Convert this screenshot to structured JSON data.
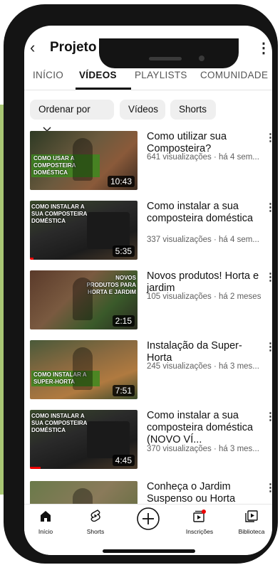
{
  "channel": {
    "title": "Projeto Raiz"
  },
  "tabs": [
    {
      "label": "INÍCIO"
    },
    {
      "label": "VÍDEOS"
    },
    {
      "label": "PLAYLISTS"
    },
    {
      "label": "COMUNIDADE"
    }
  ],
  "chips": {
    "sort": "Ordenar por",
    "videos": "Vídeos",
    "shorts": "Shorts"
  },
  "videos": [
    {
      "title": "Como utilizar sua Composteira?",
      "meta": "641 visualizações · há 4 sem...",
      "duration": "10:43",
      "thumb_text": "COMO USAR A COMPOSTEIRA DOMÉSTICA",
      "progress": 0.0
    },
    {
      "title": "Como instalar a sua composteira doméstica",
      "meta": "337 visualizações · há 4 sem...",
      "duration": "5:35",
      "thumb_text": "COMO INSTALAR A SUA COMPOSTEIRA DOMÉSTICA",
      "progress": 0.03
    },
    {
      "title": "Novos produtos! Horta e jardim",
      "meta": "105 visualizações · há 2 meses",
      "duration": "2:15",
      "thumb_text": "NOVOS PRODUTOS PARA HORTA E JARDIM",
      "progress": 0.0
    },
    {
      "title": "Instalação da Super-Horta",
      "meta": "245 visualizações · há 3 mes...",
      "duration": "7:51",
      "thumb_text": "COMO INSTALAR A SUPER-HORTA",
      "progress": 0.0
    },
    {
      "title": "Como instalar a sua composteira doméstica (NOVO VÍ...",
      "meta": "370 visualizações · há 3 mes...",
      "duration": "4:45",
      "thumb_text": "COMO INSTALAR A SUA COMPOSTEIRA DOMÉSTICA",
      "progress": 0.1
    },
    {
      "title": "Conheça o Jardim Suspenso ou Horta",
      "meta": "",
      "duration": "",
      "thumb_text": "",
      "progress": 0.0
    }
  ],
  "nav": [
    {
      "label": "Início",
      "icon": "home-icon"
    },
    {
      "label": "Shorts",
      "icon": "shorts-icon"
    },
    {
      "label": "",
      "icon": "create-icon"
    },
    {
      "label": "Inscrições",
      "icon": "subscriptions-icon"
    },
    {
      "label": "Biblioteca",
      "icon": "library-icon"
    }
  ],
  "colors": {
    "accent_green": "#a9c774",
    "thumb_tag_green": "#3d8a1f",
    "progress_red": "#e00000"
  }
}
